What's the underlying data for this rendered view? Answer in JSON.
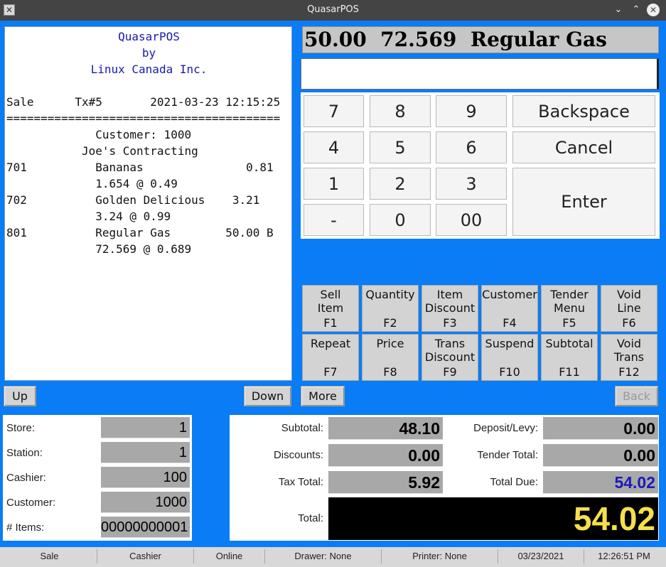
{
  "window": {
    "title": "QuasarPOS"
  },
  "receipt": {
    "header": [
      "QuasarPOS",
      "by",
      "Linux Canada Inc."
    ],
    "lines": [
      "Sale      Tx#5       2021-03-23 12:15:25",
      "========================================",
      "             Customer: 1000",
      "           Joe's Contracting",
      "701          Bananas               0.81",
      "             1.654 @ 0.49",
      "702          Golden Delicious    3.21",
      "             3.24 @ 0.99",
      "801          Regular Gas        50.00 B",
      "             72.569 @ 0.689"
    ]
  },
  "display": {
    "text": "50.00  72.569  Regular Gas"
  },
  "entry": {
    "value": ""
  },
  "keypad": {
    "k7": "7",
    "k8": "8",
    "k9": "9",
    "backspace": "Backspace",
    "k4": "4",
    "k5": "5",
    "k6": "6",
    "cancel": "Cancel",
    "k1": "1",
    "k2": "2",
    "k3": "3",
    "enter": "Enter",
    "minus": "-",
    "k0": "0",
    "k00": "00"
  },
  "function_keys": [
    {
      "label": "Sell\nItem",
      "key": "F1"
    },
    {
      "label": "Quantity",
      "key": "F2"
    },
    {
      "label": "Item\nDiscount",
      "key": "F3"
    },
    {
      "label": "Customer",
      "key": "F4"
    },
    {
      "label": "Tender\nMenu",
      "key": "F5"
    },
    {
      "label": "Void\nLine",
      "key": "F6"
    },
    {
      "label": "Repeat",
      "key": "F7"
    },
    {
      "label": "Price",
      "key": "F8"
    },
    {
      "label": "Trans\nDiscount",
      "key": "F9"
    },
    {
      "label": "Suspend",
      "key": "F10"
    },
    {
      "label": "Subtotal",
      "key": "F11"
    },
    {
      "label": "Void\nTrans",
      "key": "F12"
    }
  ],
  "nav": {
    "up": "Up",
    "down": "Down",
    "more": "More",
    "back": "Back"
  },
  "info": {
    "store_label": "Store:",
    "store": "1",
    "station_label": "Station:",
    "station": "1",
    "cashier_label": "Cashier:",
    "cashier": "100",
    "customer_label": "Customer:",
    "customer": "1000",
    "items_label": "# Items:",
    "items": "00000000001"
  },
  "totals": {
    "subtotal_label": "Subtotal:",
    "subtotal": "48.10",
    "discounts_label": "Discounts:",
    "discounts": "0.00",
    "tax_label": "Tax Total:",
    "tax": "5.92",
    "deposit_label": "Deposit/Levy:",
    "deposit": "0.00",
    "tender_label": "Tender Total:",
    "tender": "0.00",
    "due_label": "Total Due:",
    "due": "54.02",
    "total_label": "Total:",
    "total": "54.02"
  },
  "status": {
    "mode": "Sale",
    "role": "Cashier",
    "connection": "Online",
    "drawer": "Drawer: None",
    "printer": "Printer: None",
    "date": "03/23/2021",
    "time": "12:26:51 PM"
  },
  "colors": {
    "background": "#0a7cf5",
    "total_due": "#1a1ab8",
    "total_display_text": "#f5e04a",
    "receipt_header": "#1a1ab0"
  }
}
